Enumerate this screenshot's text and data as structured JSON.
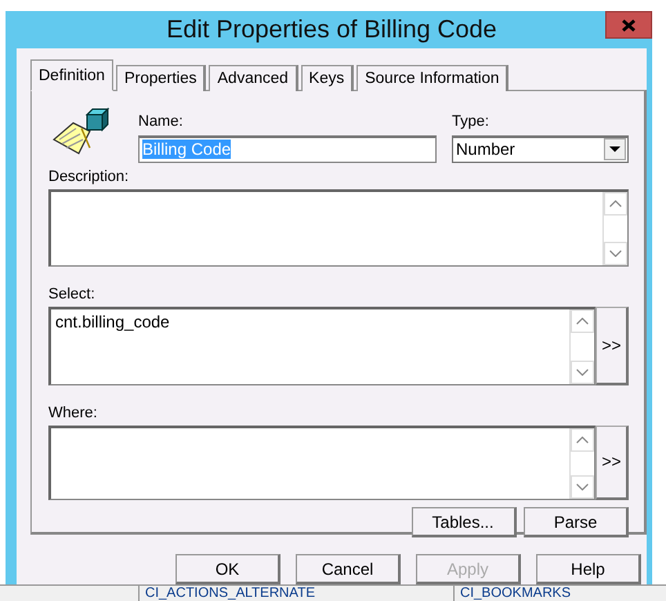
{
  "window": {
    "title": "Edit Properties of Billing Code"
  },
  "tabs": [
    {
      "label": "Definition",
      "selected": true
    },
    {
      "label": "Properties",
      "selected": false
    },
    {
      "label": "Advanced",
      "selected": false
    },
    {
      "label": "Keys",
      "selected": false
    },
    {
      "label": "Source Information",
      "selected": false
    }
  ],
  "name_field": {
    "label": "Name:",
    "value": "Billing Code",
    "highlighted": true
  },
  "type_field": {
    "label": "Type:",
    "value": "Number"
  },
  "text_areas": [
    {
      "label": "Description:"
    },
    {
      "label": "Select:",
      "value": "cnt.billing_code",
      "button": ">>"
    },
    {
      "label": "Where:",
      "button": ">>"
    }
  ],
  "panel_buttons": [
    "Tables...",
    "Parse"
  ],
  "dialog_buttons": [
    {
      "label": "OK",
      "disabled": false
    },
    {
      "label": "Cancel",
      "disabled": false
    },
    {
      "label": "Apply",
      "disabled": true
    },
    {
      "label": "Help",
      "disabled": false
    }
  ],
  "background_items": [
    "CI_ACTIONS_ALTERNATE",
    "CI_BOOKMARKS"
  ]
}
